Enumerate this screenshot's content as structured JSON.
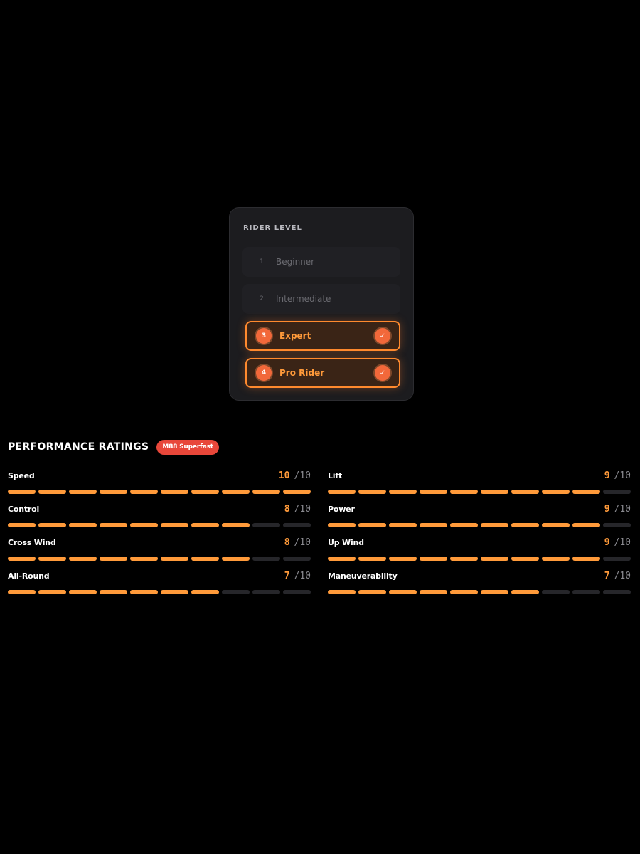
{
  "rider_level": {
    "title": "RIDER LEVEL",
    "levels": [
      {
        "number": "1",
        "label": "Beginner",
        "selected": false
      },
      {
        "number": "2",
        "label": "Intermediate",
        "selected": false
      },
      {
        "number": "3",
        "label": "Expert",
        "selected": true
      },
      {
        "number": "4",
        "label": "Pro Rider",
        "selected": true
      }
    ],
    "check_glyph": "✓"
  },
  "performance": {
    "title": "PERFORMANCE RATINGS",
    "badge": "M88 Superfast",
    "max_label": "/10",
    "max": 10,
    "ratings": [
      {
        "name": "Speed",
        "value": 10
      },
      {
        "name": "Lift",
        "value": 9
      },
      {
        "name": "Control",
        "value": 8
      },
      {
        "name": "Power",
        "value": 9
      },
      {
        "name": "Cross Wind",
        "value": 8
      },
      {
        "name": "Up Wind",
        "value": 9
      },
      {
        "name": "All-Round",
        "value": 7
      },
      {
        "name": "Maneuverability",
        "value": 7
      }
    ]
  },
  "colors": {
    "accent": "#ff9a3a",
    "badge": "#e8473a",
    "selected_circle": "#f2683a",
    "segment_off": "#26262a",
    "card_bg": "#1c1c1f"
  }
}
